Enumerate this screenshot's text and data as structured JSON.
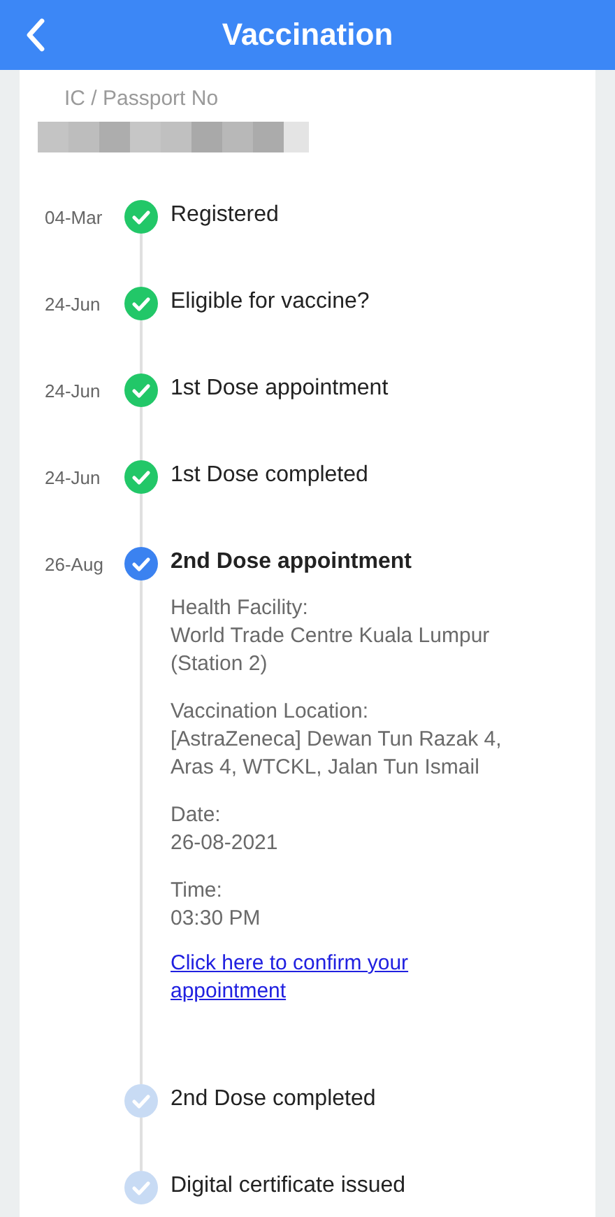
{
  "header": {
    "title": "Vaccination"
  },
  "id_field": {
    "label": "IC / Passport No"
  },
  "steps": [
    {
      "date": "04-Mar",
      "title": "Registered",
      "kind": "done"
    },
    {
      "date": "24-Jun",
      "title": "Eligible for vaccine?",
      "kind": "done"
    },
    {
      "date": "24-Jun",
      "title": "1st Dose appointment",
      "kind": "done"
    },
    {
      "date": "24-Jun",
      "title": "1st Dose completed",
      "kind": "done"
    },
    {
      "date": "26-Aug",
      "title": "2nd Dose appointment",
      "kind": "current",
      "details": [
        {
          "label": "Health Facility:",
          "value": "World Trade Centre Kuala Lumpur (Station 2)"
        },
        {
          "label": "Vaccination Location:",
          "value": "[AstraZeneca] Dewan Tun Razak 4, Aras 4, WTCKL, Jalan Tun Ismail"
        },
        {
          "label": "Date:",
          "value": "26-08-2021"
        },
        {
          "label": "Time:",
          "value": "03:30 PM"
        }
      ],
      "link": "Click here to confirm your appointment"
    },
    {
      "title": "2nd Dose completed",
      "kind": "pending"
    },
    {
      "title": "Digital certificate issued",
      "kind": "pending"
    }
  ]
}
